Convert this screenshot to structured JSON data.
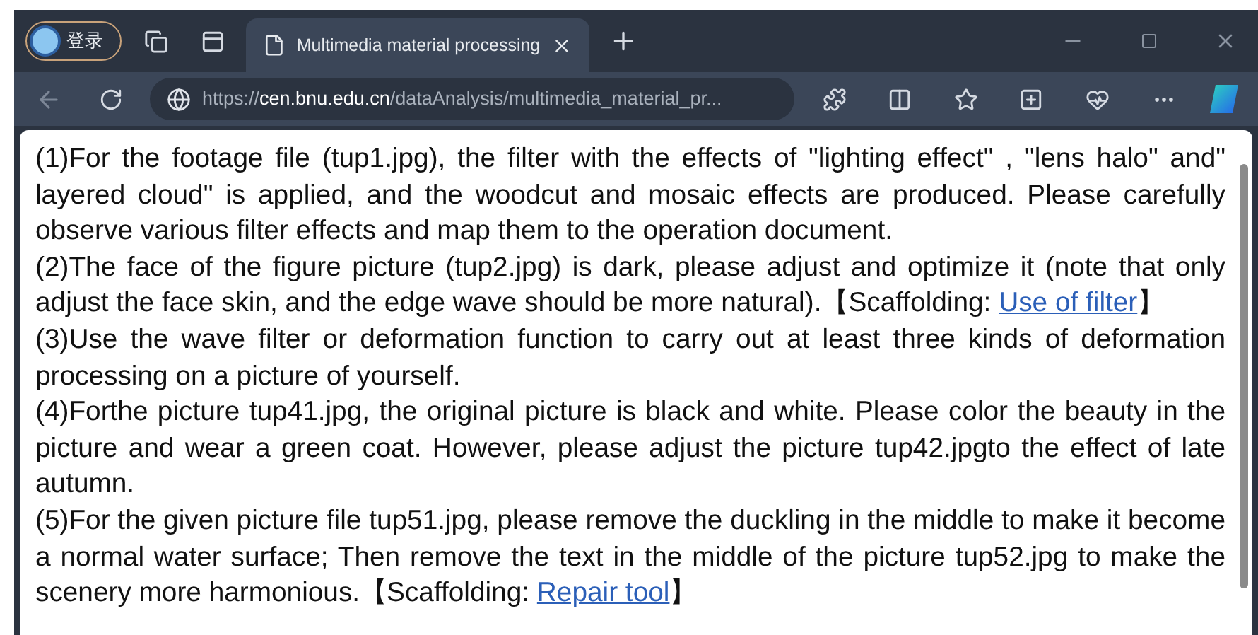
{
  "browser": {
    "profile_label": "登录",
    "tab": {
      "title": "Multimedia material processing",
      "selected": true
    },
    "url": {
      "scheme": "https://",
      "host": "cen.bnu.edu.cn",
      "path": "/dataAnalysis/multimedia_material_pr..."
    }
  },
  "paragraphs": [
    {
      "text": "(1)For the footage file (tup1.jpg), the filter with the effects of \"lighting effect\" , \"lens halo\" and\" layered cloud\" is applied, and the woodcut and mosaic effects are produced. Please carefully observe various filter effects and map them to the operation document."
    },
    {
      "text": "(2)The face of the figure picture (tup2.jpg) is dark, please adjust and optimize it (note that only adjust the face skin, and the edge wave should be more natural).【Scaffolding: ",
      "link": "Use of filter",
      "tail": "】"
    },
    {
      "text": "(3)Use the wave filter or deformation function to carry out at least three kinds of deformation processing on a picture of yourself."
    },
    {
      "text": "(4)Forthe picture tup41.jpg, the original picture is black and white. Please color the beauty in the picture and wear a green coat. However, please adjust the picture tup42.jpgto the effect of late autumn."
    },
    {
      "text": "(5)For the given picture file tup51.jpg, please remove the duckling in the middle to make it become a normal water surface; Then remove the text in the middle of the picture tup52.jpg to make the scenery more harmonious.【Scaffolding: ",
      "link": "Repair tool",
      "tail": "】"
    }
  ]
}
